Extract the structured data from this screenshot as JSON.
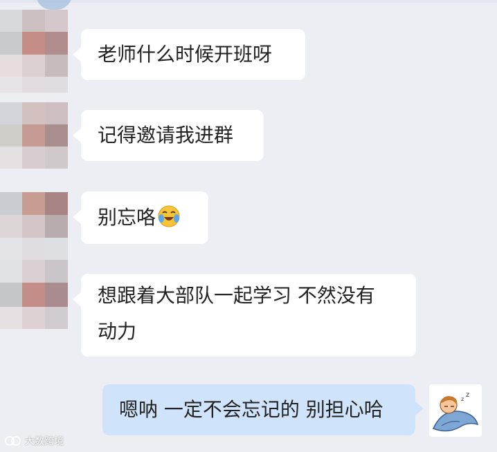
{
  "chat": {
    "messages": [
      {
        "sender": "other",
        "text": "老师什么时候开班呀"
      },
      {
        "sender": "other",
        "text": "记得邀请我进群"
      },
      {
        "sender": "other",
        "text": "别忘咯",
        "emoji": "laughing-crying-face-icon"
      },
      {
        "sender": "other",
        "line1": "想跟着大部队一起学习 不然没有",
        "line2": "动力"
      },
      {
        "sender": "self",
        "text": "嗯呐 一定不会忘记的 别担心哈"
      }
    ]
  },
  "watermark": {
    "text": "大数跨境",
    "logo": "brand-logo-icon"
  },
  "colors": {
    "background": "#edeef3",
    "incoming_bubble": "#ffffff",
    "outgoing_bubble": "#cfe4fb",
    "text": "#222222"
  }
}
